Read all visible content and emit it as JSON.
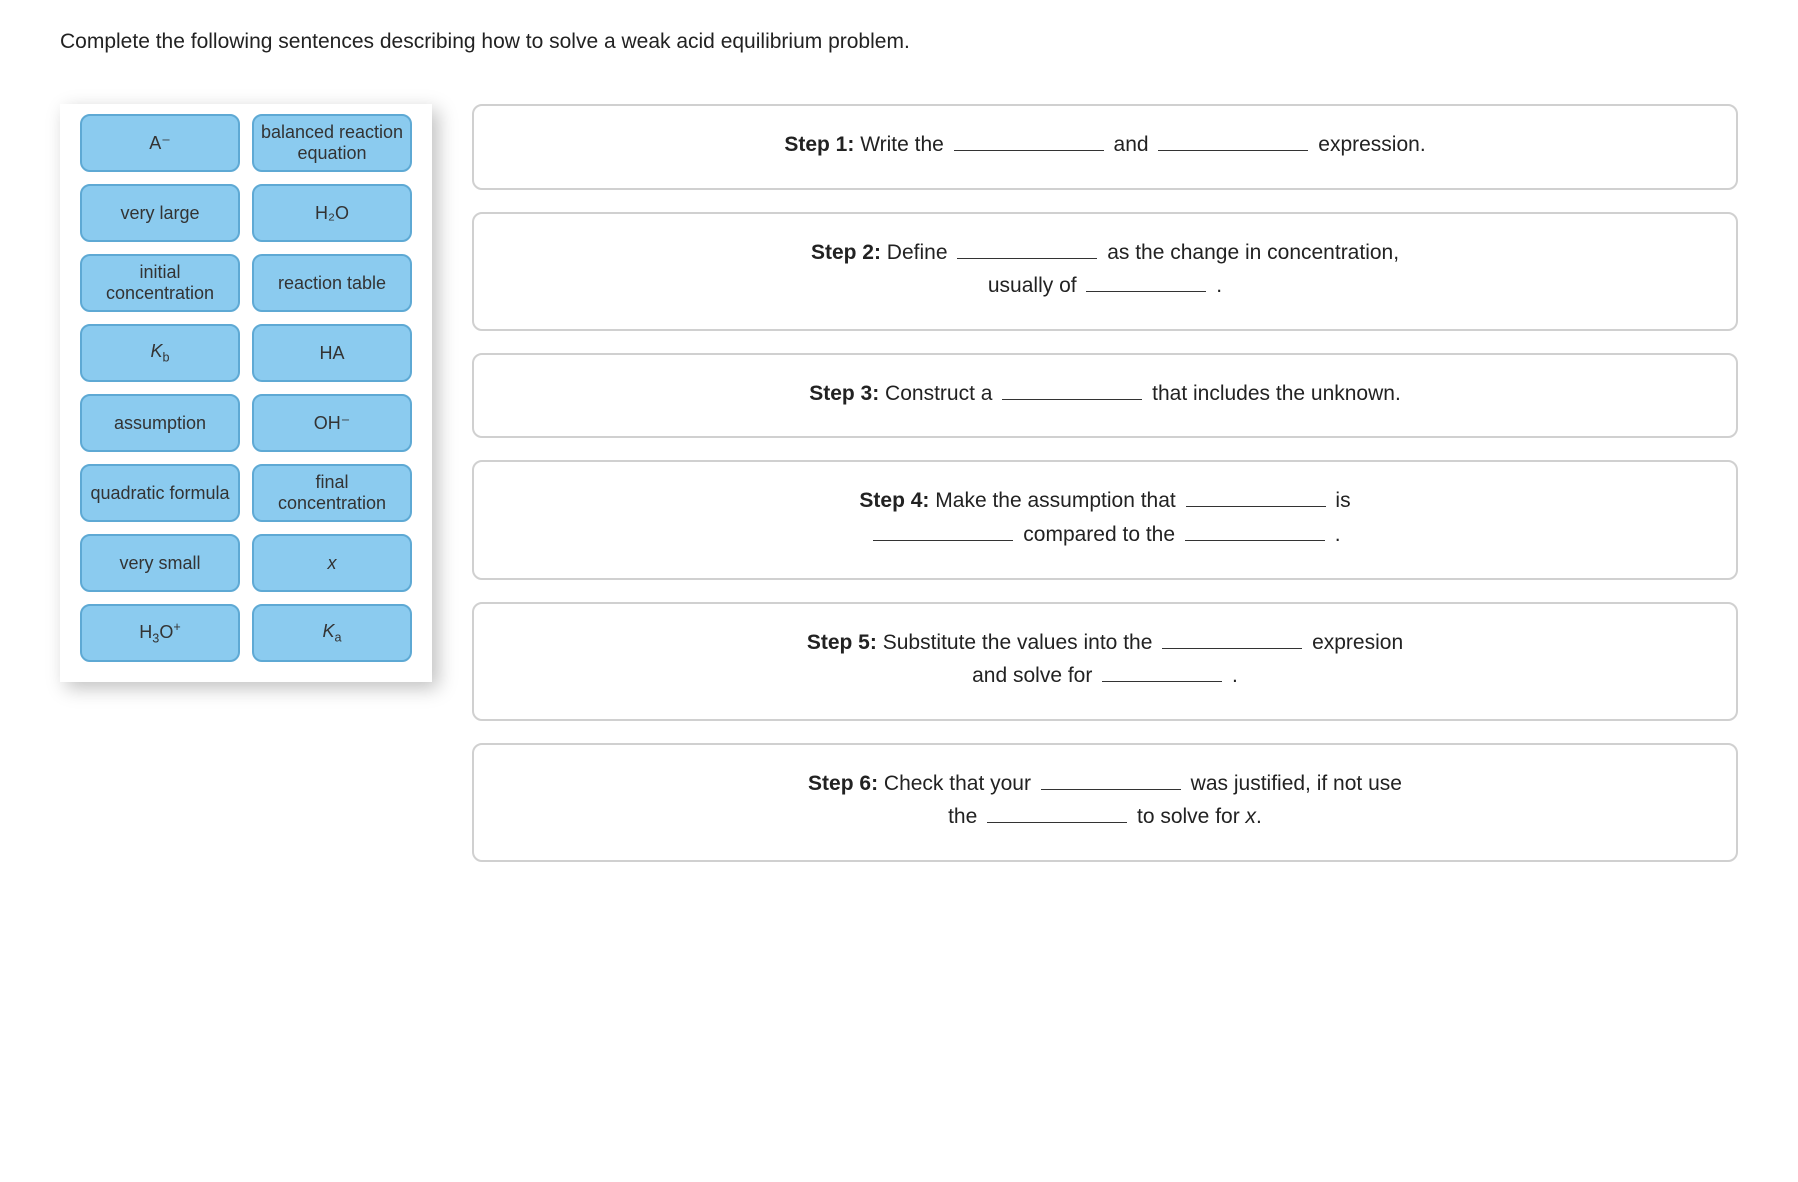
{
  "prompt": "Complete the following sentences describing how to solve a weak acid equilibrium problem.",
  "tiles": {
    "a_minus": "A⁻",
    "balanced_eq": "balanced reaction equation",
    "very_large": "very large",
    "h2o": "H₂O",
    "initial_conc": "initial concentration",
    "reaction_table": "reaction table",
    "kb": "K",
    "kb_sub": "b",
    "ha": "HA",
    "assumption": "assumption",
    "oh_minus": "OH⁻",
    "quadratic": "quadratic formula",
    "final_conc": "final concentration",
    "very_small": "very small",
    "x": "x",
    "h3o_plus_base": "H",
    "h3o_plus_sub": "3",
    "h3o_plus_rest": "O",
    "h3o_plus_sup": "+",
    "ka": "K",
    "ka_sub": "a"
  },
  "steps": {
    "s1": {
      "label": "Step 1:",
      "a": "Write the",
      "b": "and",
      "c": "expression."
    },
    "s2": {
      "label": "Step 2:",
      "a": "Define",
      "b": "as the change in concentration,",
      "c": "usually of",
      "d": "."
    },
    "s3": {
      "label": "Step 3:",
      "a": "Construct a",
      "b": "that includes the unknown."
    },
    "s4": {
      "label": "Step 4:",
      "a": "Make the assumption that",
      "b": "is",
      "c": "compared to the",
      "d": "."
    },
    "s5": {
      "label": "Step 5:",
      "a": "Substitute the values into the",
      "b": "expresion",
      "c": "and solve for",
      "d": "."
    },
    "s6": {
      "label": "Step 6:",
      "a": "Check that your",
      "b": "was justified, if not use",
      "c": "the",
      "d": "to solve for",
      "e": "x",
      "f": "."
    }
  }
}
